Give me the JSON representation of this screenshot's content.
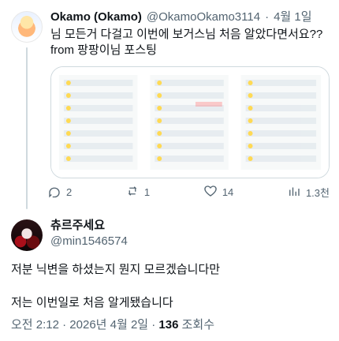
{
  "parent": {
    "name": "Okamo (Okamo)",
    "handle": "@OkamoOkamo3114",
    "separator": "·",
    "time": "4월 1일",
    "text_lines": [
      "님 모든거 다걸고 이번에 보거스님 처음 알았다면서요??",
      "from 팡팡이님 포스팅"
    ],
    "actions": {
      "replies": "2",
      "retweets": "1",
      "likes": "14",
      "views": "1.3천"
    }
  },
  "reply": {
    "name": "츄르주세요",
    "handle": "@min1546574",
    "text_1": "저분 닉변을 하셨는지 뭔지 모르겠습니다만",
    "text_2": "저는 이번일로 처음 알게됐습니다",
    "meta_time": "오전 2:12 · 2026년 4월 2일 · ",
    "meta_views_number": "136",
    "meta_views_label": " 조회수"
  },
  "icons": {
    "reply": "reply-icon",
    "retweet": "retweet-icon",
    "like": "heart-icon",
    "views": "views-icon"
  },
  "colors": {
    "text": "#0f1419",
    "muted": "#536471",
    "border": "#cfd9de"
  }
}
